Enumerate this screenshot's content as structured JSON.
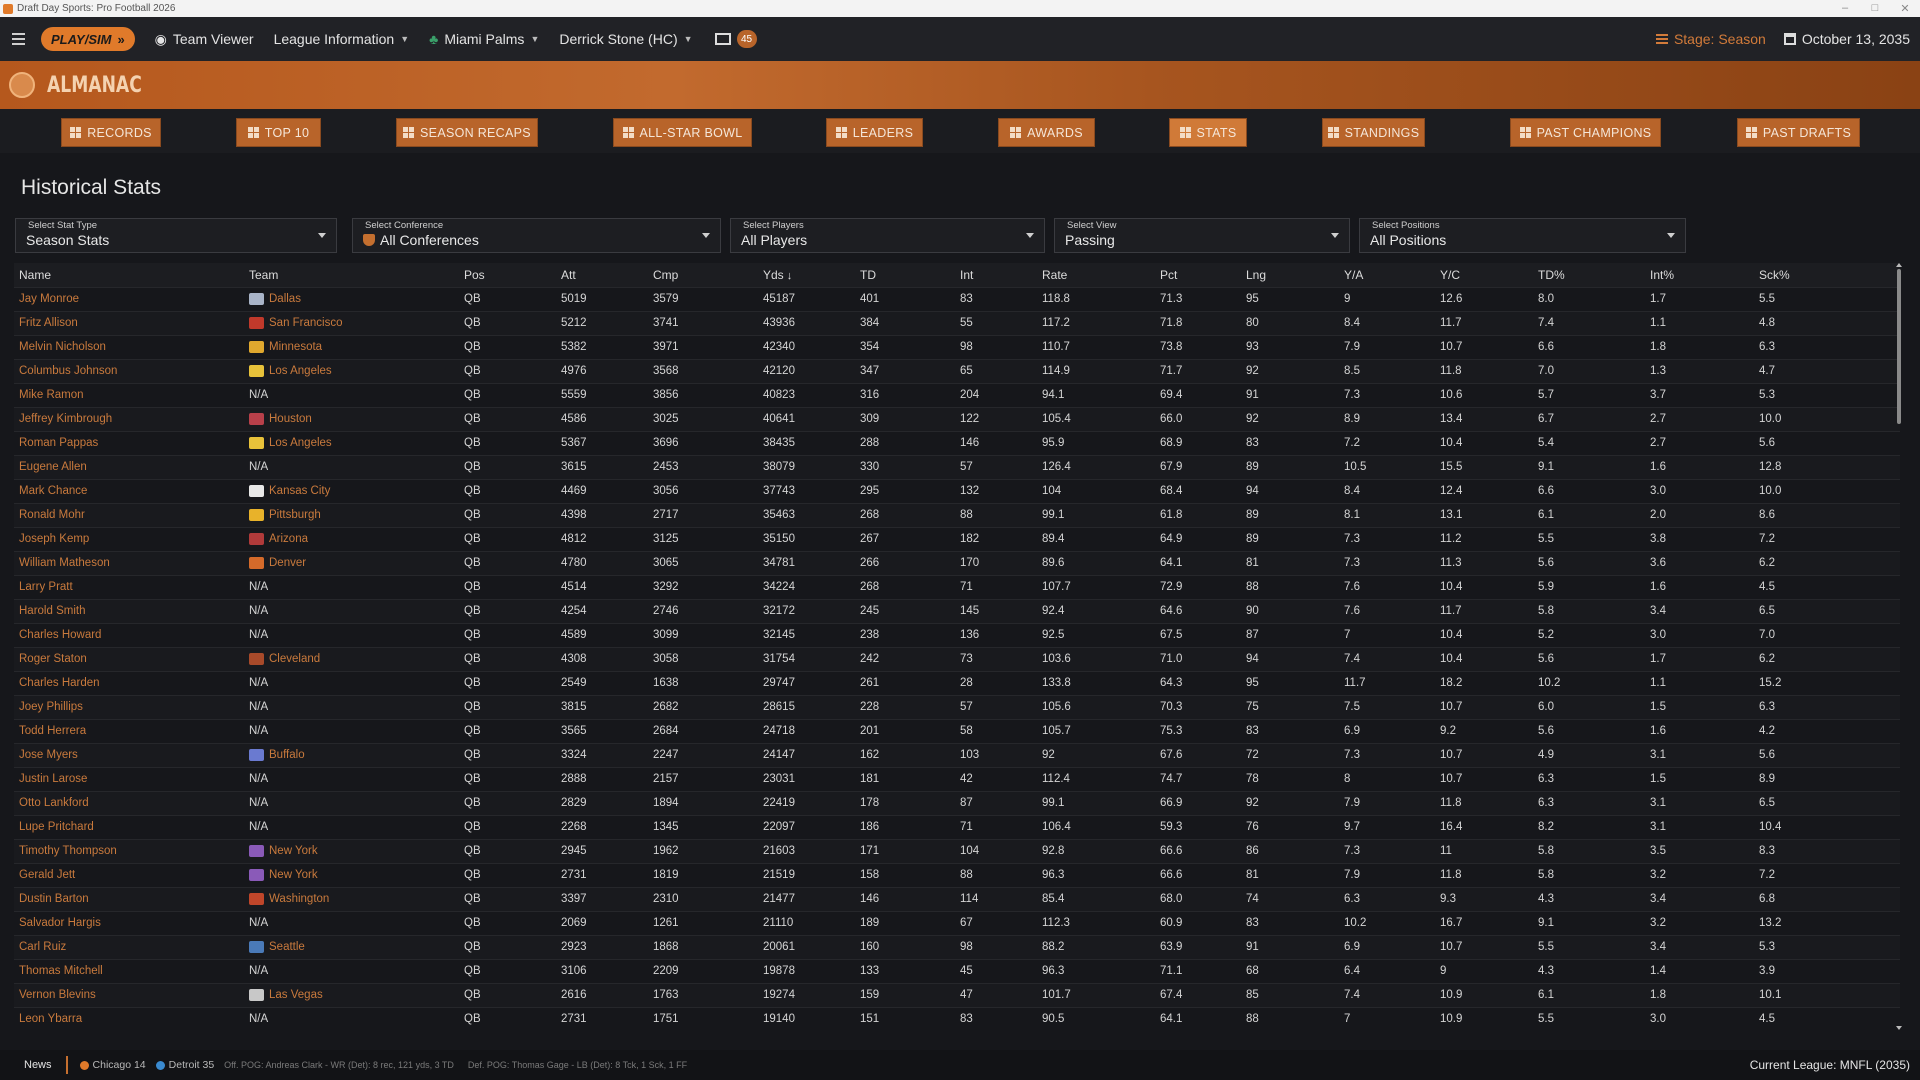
{
  "window": {
    "title": "Draft Day Sports: Pro Football 2026"
  },
  "topnav": {
    "playsim_label": "PLAY/SIM",
    "team_viewer": "Team Viewer",
    "league_info": "League Information",
    "team": "Miami Palms",
    "coach": "Derrick Stone (HC)",
    "mail_count": "45",
    "stage": "Stage: Season",
    "date": "October 13, 2035"
  },
  "banner": {
    "title": "ALMANAC"
  },
  "tabs": [
    {
      "label": "RECORDS"
    },
    {
      "label": "TOP 10"
    },
    {
      "label": "SEASON RECAPS"
    },
    {
      "label": "ALL-STAR BOWL"
    },
    {
      "label": "LEADERS"
    },
    {
      "label": "AWARDS"
    },
    {
      "label": "STATS"
    },
    {
      "label": "STANDINGS"
    },
    {
      "label": "PAST CHAMPIONS"
    },
    {
      "label": "PAST DRAFTS"
    }
  ],
  "page_title": "Historical Stats",
  "filters": {
    "stat_type": {
      "label": "Select Stat Type",
      "value": "Season Stats"
    },
    "conference": {
      "label": "Select Conference",
      "value": "All Conferences"
    },
    "players": {
      "label": "Select Players",
      "value": "All Players"
    },
    "view": {
      "label": "Select View",
      "value": "Passing"
    },
    "positions": {
      "label": "Select Positions",
      "value": "All Positions"
    }
  },
  "columns": [
    "Name",
    "Team",
    "Pos",
    "Att",
    "Cmp",
    "Yds",
    "TD",
    "Int",
    "Rate",
    "Pct",
    "Lng",
    "Y/A",
    "Y/C",
    "TD%",
    "Int%",
    "Sck%"
  ],
  "sort_column": "Yds",
  "rows": [
    [
      "Jay Monroe",
      "Dallas",
      "QB",
      "5019",
      "3579",
      "45187",
      "401",
      "83",
      "118.8",
      "71.3",
      "95",
      "9",
      "12.6",
      "8.0",
      "1.7",
      "5.5"
    ],
    [
      "Fritz Allison",
      "San Francisco",
      "QB",
      "5212",
      "3741",
      "43936",
      "384",
      "55",
      "117.2",
      "71.8",
      "80",
      "8.4",
      "11.7",
      "7.4",
      "1.1",
      "4.8"
    ],
    [
      "Melvin Nicholson",
      "Minnesota",
      "QB",
      "5382",
      "3971",
      "42340",
      "354",
      "98",
      "110.7",
      "73.8",
      "93",
      "7.9",
      "10.7",
      "6.6",
      "1.8",
      "6.3"
    ],
    [
      "Columbus Johnson",
      "Los Angeles",
      "QB",
      "4976",
      "3568",
      "42120",
      "347",
      "65",
      "114.9",
      "71.7",
      "92",
      "8.5",
      "11.8",
      "7.0",
      "1.3",
      "4.7"
    ],
    [
      "Mike Ramon",
      "N/A",
      "QB",
      "5559",
      "3856",
      "40823",
      "316",
      "204",
      "94.1",
      "69.4",
      "91",
      "7.3",
      "10.6",
      "5.7",
      "3.7",
      "5.3"
    ],
    [
      "Jeffrey Kimbrough",
      "Houston",
      "QB",
      "4586",
      "3025",
      "40641",
      "309",
      "122",
      "105.4",
      "66.0",
      "92",
      "8.9",
      "13.4",
      "6.7",
      "2.7",
      "10.0"
    ],
    [
      "Roman Pappas",
      "Los Angeles",
      "QB",
      "5367",
      "3696",
      "38435",
      "288",
      "146",
      "95.9",
      "68.9",
      "83",
      "7.2",
      "10.4",
      "5.4",
      "2.7",
      "5.6"
    ],
    [
      "Eugene Allen",
      "N/A",
      "QB",
      "3615",
      "2453",
      "38079",
      "330",
      "57",
      "126.4",
      "67.9",
      "89",
      "10.5",
      "15.5",
      "9.1",
      "1.6",
      "12.8"
    ],
    [
      "Mark Chance",
      "Kansas City",
      "QB",
      "4469",
      "3056",
      "37743",
      "295",
      "132",
      "104",
      "68.4",
      "94",
      "8.4",
      "12.4",
      "6.6",
      "3.0",
      "10.0"
    ],
    [
      "Ronald Mohr",
      "Pittsburgh",
      "QB",
      "4398",
      "2717",
      "35463",
      "268",
      "88",
      "99.1",
      "61.8",
      "89",
      "8.1",
      "13.1",
      "6.1",
      "2.0",
      "8.6"
    ],
    [
      "Joseph Kemp",
      "Arizona",
      "QB",
      "4812",
      "3125",
      "35150",
      "267",
      "182",
      "89.4",
      "64.9",
      "89",
      "7.3",
      "11.2",
      "5.5",
      "3.8",
      "7.2"
    ],
    [
      "William Matheson",
      "Denver",
      "QB",
      "4780",
      "3065",
      "34781",
      "266",
      "170",
      "89.6",
      "64.1",
      "81",
      "7.3",
      "11.3",
      "5.6",
      "3.6",
      "6.2"
    ],
    [
      "Larry Pratt",
      "N/A",
      "QB",
      "4514",
      "3292",
      "34224",
      "268",
      "71",
      "107.7",
      "72.9",
      "88",
      "7.6",
      "10.4",
      "5.9",
      "1.6",
      "4.5"
    ],
    [
      "Harold Smith",
      "N/A",
      "QB",
      "4254",
      "2746",
      "32172",
      "245",
      "145",
      "92.4",
      "64.6",
      "90",
      "7.6",
      "11.7",
      "5.8",
      "3.4",
      "6.5"
    ],
    [
      "Charles Howard",
      "N/A",
      "QB",
      "4589",
      "3099",
      "32145",
      "238",
      "136",
      "92.5",
      "67.5",
      "87",
      "7",
      "10.4",
      "5.2",
      "3.0",
      "7.0"
    ],
    [
      "Roger Staton",
      "Cleveland",
      "QB",
      "4308",
      "3058",
      "31754",
      "242",
      "73",
      "103.6",
      "71.0",
      "94",
      "7.4",
      "10.4",
      "5.6",
      "1.7",
      "6.2"
    ],
    [
      "Charles Harden",
      "N/A",
      "QB",
      "2549",
      "1638",
      "29747",
      "261",
      "28",
      "133.8",
      "64.3",
      "95",
      "11.7",
      "18.2",
      "10.2",
      "1.1",
      "15.2"
    ],
    [
      "Joey Phillips",
      "N/A",
      "QB",
      "3815",
      "2682",
      "28615",
      "228",
      "57",
      "105.6",
      "70.3",
      "75",
      "7.5",
      "10.7",
      "6.0",
      "1.5",
      "6.3"
    ],
    [
      "Todd Herrera",
      "N/A",
      "QB",
      "3565",
      "2684",
      "24718",
      "201",
      "58",
      "105.7",
      "75.3",
      "83",
      "6.9",
      "9.2",
      "5.6",
      "1.6",
      "4.2"
    ],
    [
      "Jose Myers",
      "Buffalo",
      "QB",
      "3324",
      "2247",
      "24147",
      "162",
      "103",
      "92",
      "67.6",
      "72",
      "7.3",
      "10.7",
      "4.9",
      "3.1",
      "5.6"
    ],
    [
      "Justin Larose",
      "N/A",
      "QB",
      "2888",
      "2157",
      "23031",
      "181",
      "42",
      "112.4",
      "74.7",
      "78",
      "8",
      "10.7",
      "6.3",
      "1.5",
      "8.9"
    ],
    [
      "Otto Lankford",
      "N/A",
      "QB",
      "2829",
      "1894",
      "22419",
      "178",
      "87",
      "99.1",
      "66.9",
      "92",
      "7.9",
      "11.8",
      "6.3",
      "3.1",
      "6.5"
    ],
    [
      "Lupe Pritchard",
      "N/A",
      "QB",
      "2268",
      "1345",
      "22097",
      "186",
      "71",
      "106.4",
      "59.3",
      "76",
      "9.7",
      "16.4",
      "8.2",
      "3.1",
      "10.4"
    ],
    [
      "Timothy Thompson",
      "New York",
      "QB",
      "2945",
      "1962",
      "21603",
      "171",
      "104",
      "92.8",
      "66.6",
      "86",
      "7.3",
      "11",
      "5.8",
      "3.5",
      "8.3"
    ],
    [
      "Gerald Jett",
      "New York",
      "QB",
      "2731",
      "1819",
      "21519",
      "158",
      "88",
      "96.3",
      "66.6",
      "81",
      "7.9",
      "11.8",
      "5.8",
      "3.2",
      "7.2"
    ],
    [
      "Dustin Barton",
      "Washington",
      "QB",
      "3397",
      "2310",
      "21477",
      "146",
      "114",
      "85.4",
      "68.0",
      "74",
      "6.3",
      "9.3",
      "4.3",
      "3.4",
      "6.8"
    ],
    [
      "Salvador Hargis",
      "N/A",
      "QB",
      "2069",
      "1261",
      "21110",
      "189",
      "67",
      "112.3",
      "60.9",
      "83",
      "10.2",
      "16.7",
      "9.1",
      "3.2",
      "13.2"
    ],
    [
      "Carl Ruiz",
      "Seattle",
      "QB",
      "2923",
      "1868",
      "20061",
      "160",
      "98",
      "88.2",
      "63.9",
      "91",
      "6.9",
      "10.7",
      "5.5",
      "3.4",
      "5.3"
    ],
    [
      "Thomas Mitchell",
      "N/A",
      "QB",
      "3106",
      "2209",
      "19878",
      "133",
      "45",
      "96.3",
      "71.1",
      "68",
      "6.4",
      "9",
      "4.3",
      "1.4",
      "3.9"
    ],
    [
      "Vernon Blevins",
      "Las Vegas",
      "QB",
      "2616",
      "1763",
      "19274",
      "159",
      "47",
      "101.7",
      "67.4",
      "85",
      "7.4",
      "10.9",
      "6.1",
      "1.8",
      "10.1"
    ],
    [
      "Leon Ybarra",
      "N/A",
      "QB",
      "2731",
      "1751",
      "19140",
      "151",
      "83",
      "90.5",
      "64.1",
      "88",
      "7",
      "10.9",
      "5.5",
      "3.0",
      "4.5"
    ]
  ],
  "team_colors": {
    "Dallas": "#a9b4c8",
    "San Francisco": "#c0392b",
    "Minnesota": "#e0a82e",
    "Los Angeles": "#e8c23a",
    "Houston": "#b8404a",
    "Kansas City": "#e8e8e8",
    "Pittsburgh": "#e8b22a",
    "Arizona": "#b03a3a",
    "Denver": "#d46a2a",
    "Cleveland": "#a84a2a",
    "Buffalo": "#6a7ad0",
    "New York": "#8a5ab8",
    "Washington": "#c0462a",
    "Seattle": "#4a7ab8",
    "Las Vegas": "#c8c8c8"
  },
  "ticker": {
    "news_label": "News",
    "score1": "Chicago 14",
    "score2": "Detroit 35",
    "off_pog": "Off. POG: Andreas Clark - WR (Det): 8 rec, 121 yds, 3 TD",
    "def_pog": "Def. POG: Thomas Gage - LB (Det): 8 Tck, 1 Sck, 1 FF",
    "current_league": "Current League: MNFL (2035)"
  },
  "accent_color": "#d07a38"
}
